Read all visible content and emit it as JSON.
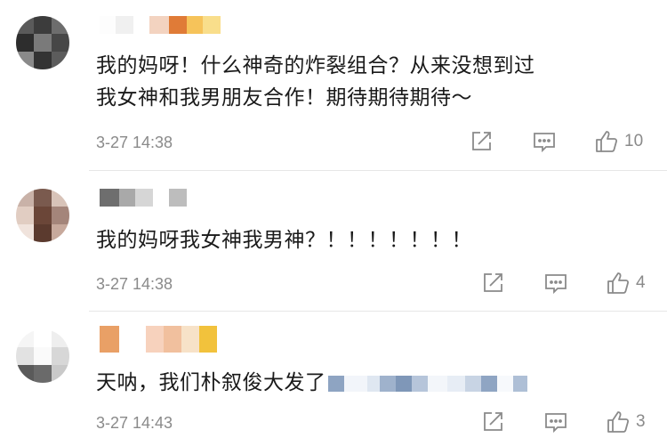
{
  "comments": [
    {
      "text_lines": [
        "我的妈呀！什么神奇的炸裂组合？从来没想到过",
        "我女神和我男朋友合作！期待期待期待～"
      ],
      "timestamp": "3-27 14:38",
      "like_count": "10",
      "icons": {
        "share": "share-icon",
        "reply": "comment-icon",
        "like": "thumbs-up-icon"
      }
    },
    {
      "text_lines": [
        "我的妈呀我女神我男神？！！！！！！！"
      ],
      "timestamp": "3-27 14:38",
      "like_count": "4",
      "icons": {
        "share": "share-icon",
        "reply": "comment-icon",
        "like": "thumbs-up-icon"
      }
    },
    {
      "text_lines": [
        "天呐，我们朴叙俊大发了"
      ],
      "timestamp": "3-27 14:43",
      "like_count": "3",
      "icons": {
        "share": "share-icon",
        "reply": "comment-icon",
        "like": "thumbs-up-icon"
      }
    }
  ],
  "colors": {
    "meta_gray": "#8a8a8a",
    "text": "#1a1a1a",
    "divider": "#e6e6e6"
  }
}
